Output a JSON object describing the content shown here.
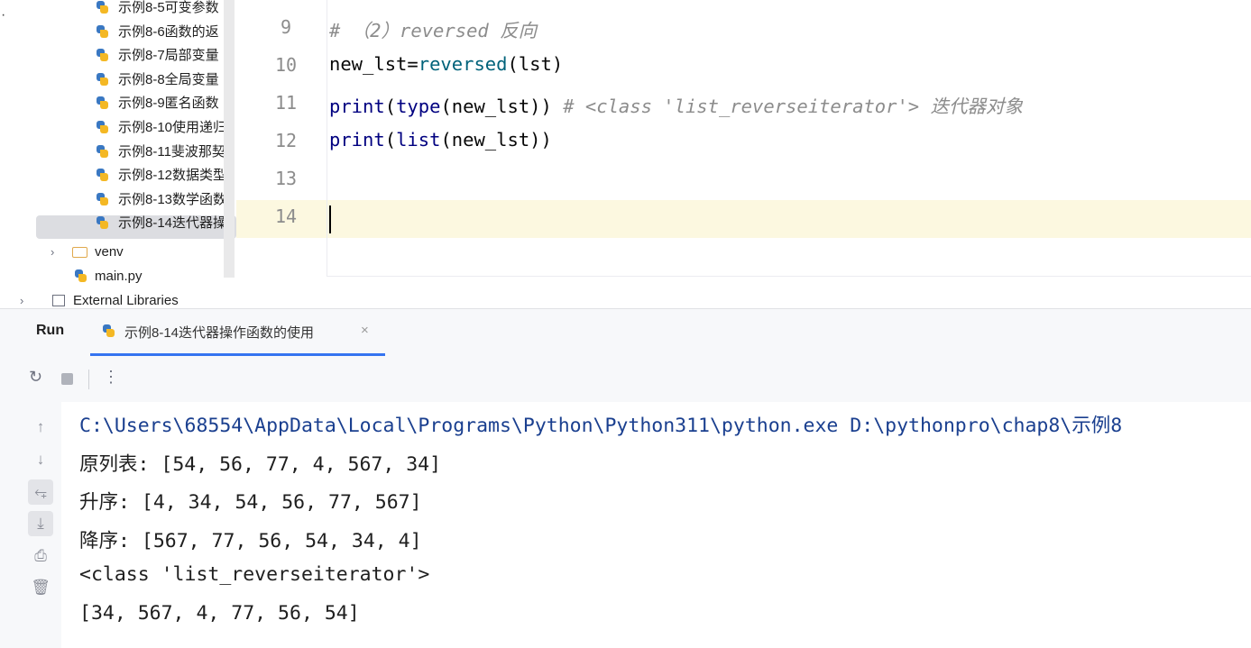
{
  "project_tree": {
    "items": [
      {
        "label": "示例8-5可变参数",
        "kind": "python-file"
      },
      {
        "label": "示例8-6函数的返",
        "kind": "python-file"
      },
      {
        "label": "示例8-7局部变量",
        "kind": "python-file"
      },
      {
        "label": "示例8-8全局变量",
        "kind": "python-file"
      },
      {
        "label": "示例8-9匿名函数",
        "kind": "python-file"
      },
      {
        "label": "示例8-10使用递归",
        "kind": "python-file"
      },
      {
        "label": "示例8-11斐波那契",
        "kind": "python-file"
      },
      {
        "label": "示例8-12数据类型",
        "kind": "python-file"
      },
      {
        "label": "示例8-13数学函数",
        "kind": "python-file"
      },
      {
        "label": "示例8-14迭代器操",
        "kind": "python-file",
        "selected": true
      }
    ],
    "venv_label": "venv",
    "main_label": "main.py",
    "external_label": "External Libraries"
  },
  "editor": {
    "lines": [
      {
        "num": "9",
        "parts": [
          {
            "t": "# （2）reversed 反向",
            "s": "comment"
          }
        ]
      },
      {
        "num": "10",
        "parts": [
          {
            "t": "new_lst=",
            "s": "plain"
          },
          {
            "t": "reversed",
            "s": "call"
          },
          {
            "t": "(lst)",
            "s": "plain"
          }
        ]
      },
      {
        "num": "11",
        "parts": [
          {
            "t": "print",
            "s": "builtin"
          },
          {
            "t": "(",
            "s": "plain"
          },
          {
            "t": "type",
            "s": "builtin"
          },
          {
            "t": "(new_lst)) ",
            "s": "plain"
          },
          {
            "t": "# <class 'list_reverseiterator'> 迭代器对象",
            "s": "comment"
          }
        ]
      },
      {
        "num": "12",
        "parts": [
          {
            "t": "print",
            "s": "builtin"
          },
          {
            "t": "(",
            "s": "plain"
          },
          {
            "t": "list",
            "s": "builtin"
          },
          {
            "t": "(new_lst))",
            "s": "plain"
          }
        ]
      },
      {
        "num": "13",
        "parts": []
      },
      {
        "num": "14",
        "parts": []
      }
    ],
    "current_line": "14"
  },
  "run_panel": {
    "title": "Run",
    "tab_label": "示例8-14迭代器操作函数的使用",
    "tab_close": "×",
    "output": [
      "C:\\Users\\68554\\AppData\\Local\\Programs\\Python\\Python311\\python.exe D:\\pythonpro\\chap8\\示例8",
      "原列表: [54, 56, 77, 4, 567, 34]",
      "升序: [4, 34, 54, 56, 77, 567]",
      "降序: [567, 77, 56, 54, 34, 4]",
      "<class 'list_reverseiterator'>",
      "[34, 567, 4, 77, 56, 54]"
    ]
  },
  "icons": {
    "rerun": "rerun-icon",
    "stop": "stop-icon",
    "more": "more-icon",
    "up": "arrow-up-icon",
    "down": "arrow-down-icon",
    "wrap": "soft-wrap-icon",
    "scroll_end": "scroll-to-end-icon",
    "print": "print-icon",
    "trash": "trash-icon"
  },
  "colors": {
    "accent": "#3574f0",
    "current_line_bg": "#fcf8e0",
    "selection_bg": "#dcdde1"
  }
}
